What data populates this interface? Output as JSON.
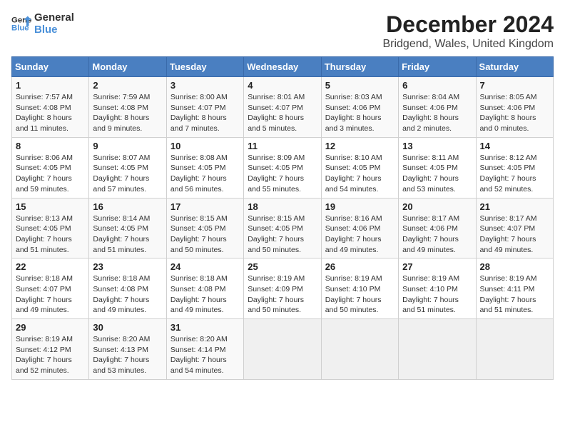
{
  "logo": {
    "line1": "General",
    "line2": "Blue"
  },
  "title": "December 2024",
  "subtitle": "Bridgend, Wales, United Kingdom",
  "days_of_week": [
    "Sunday",
    "Monday",
    "Tuesday",
    "Wednesday",
    "Thursday",
    "Friday",
    "Saturday"
  ],
  "weeks": [
    [
      {
        "day": 1,
        "sunrise": "7:57 AM",
        "sunset": "4:08 PM",
        "daylight": "8 hours and 11 minutes."
      },
      {
        "day": 2,
        "sunrise": "7:59 AM",
        "sunset": "4:08 PM",
        "daylight": "8 hours and 9 minutes."
      },
      {
        "day": 3,
        "sunrise": "8:00 AM",
        "sunset": "4:07 PM",
        "daylight": "8 hours and 7 minutes."
      },
      {
        "day": 4,
        "sunrise": "8:01 AM",
        "sunset": "4:07 PM",
        "daylight": "8 hours and 5 minutes."
      },
      {
        "day": 5,
        "sunrise": "8:03 AM",
        "sunset": "4:06 PM",
        "daylight": "8 hours and 3 minutes."
      },
      {
        "day": 6,
        "sunrise": "8:04 AM",
        "sunset": "4:06 PM",
        "daylight": "8 hours and 2 minutes."
      },
      {
        "day": 7,
        "sunrise": "8:05 AM",
        "sunset": "4:06 PM",
        "daylight": "8 hours and 0 minutes."
      }
    ],
    [
      {
        "day": 8,
        "sunrise": "8:06 AM",
        "sunset": "4:05 PM",
        "daylight": "7 hours and 59 minutes."
      },
      {
        "day": 9,
        "sunrise": "8:07 AM",
        "sunset": "4:05 PM",
        "daylight": "7 hours and 57 minutes."
      },
      {
        "day": 10,
        "sunrise": "8:08 AM",
        "sunset": "4:05 PM",
        "daylight": "7 hours and 56 minutes."
      },
      {
        "day": 11,
        "sunrise": "8:09 AM",
        "sunset": "4:05 PM",
        "daylight": "7 hours and 55 minutes."
      },
      {
        "day": 12,
        "sunrise": "8:10 AM",
        "sunset": "4:05 PM",
        "daylight": "7 hours and 54 minutes."
      },
      {
        "day": 13,
        "sunrise": "8:11 AM",
        "sunset": "4:05 PM",
        "daylight": "7 hours and 53 minutes."
      },
      {
        "day": 14,
        "sunrise": "8:12 AM",
        "sunset": "4:05 PM",
        "daylight": "7 hours and 52 minutes."
      }
    ],
    [
      {
        "day": 15,
        "sunrise": "8:13 AM",
        "sunset": "4:05 PM",
        "daylight": "7 hours and 51 minutes."
      },
      {
        "day": 16,
        "sunrise": "8:14 AM",
        "sunset": "4:05 PM",
        "daylight": "7 hours and 51 minutes."
      },
      {
        "day": 17,
        "sunrise": "8:15 AM",
        "sunset": "4:05 PM",
        "daylight": "7 hours and 50 minutes."
      },
      {
        "day": 18,
        "sunrise": "8:15 AM",
        "sunset": "4:05 PM",
        "daylight": "7 hours and 50 minutes."
      },
      {
        "day": 19,
        "sunrise": "8:16 AM",
        "sunset": "4:06 PM",
        "daylight": "7 hours and 49 minutes."
      },
      {
        "day": 20,
        "sunrise": "8:17 AM",
        "sunset": "4:06 PM",
        "daylight": "7 hours and 49 minutes."
      },
      {
        "day": 21,
        "sunrise": "8:17 AM",
        "sunset": "4:07 PM",
        "daylight": "7 hours and 49 minutes."
      }
    ],
    [
      {
        "day": 22,
        "sunrise": "8:18 AM",
        "sunset": "4:07 PM",
        "daylight": "7 hours and 49 minutes."
      },
      {
        "day": 23,
        "sunrise": "8:18 AM",
        "sunset": "4:08 PM",
        "daylight": "7 hours and 49 minutes."
      },
      {
        "day": 24,
        "sunrise": "8:18 AM",
        "sunset": "4:08 PM",
        "daylight": "7 hours and 49 minutes."
      },
      {
        "day": 25,
        "sunrise": "8:19 AM",
        "sunset": "4:09 PM",
        "daylight": "7 hours and 50 minutes."
      },
      {
        "day": 26,
        "sunrise": "8:19 AM",
        "sunset": "4:10 PM",
        "daylight": "7 hours and 50 minutes."
      },
      {
        "day": 27,
        "sunrise": "8:19 AM",
        "sunset": "4:10 PM",
        "daylight": "7 hours and 51 minutes."
      },
      {
        "day": 28,
        "sunrise": "8:19 AM",
        "sunset": "4:11 PM",
        "daylight": "7 hours and 51 minutes."
      }
    ],
    [
      {
        "day": 29,
        "sunrise": "8:19 AM",
        "sunset": "4:12 PM",
        "daylight": "7 hours and 52 minutes."
      },
      {
        "day": 30,
        "sunrise": "8:20 AM",
        "sunset": "4:13 PM",
        "daylight": "7 hours and 53 minutes."
      },
      {
        "day": 31,
        "sunrise": "8:20 AM",
        "sunset": "4:14 PM",
        "daylight": "7 hours and 54 minutes."
      },
      null,
      null,
      null,
      null
    ]
  ]
}
